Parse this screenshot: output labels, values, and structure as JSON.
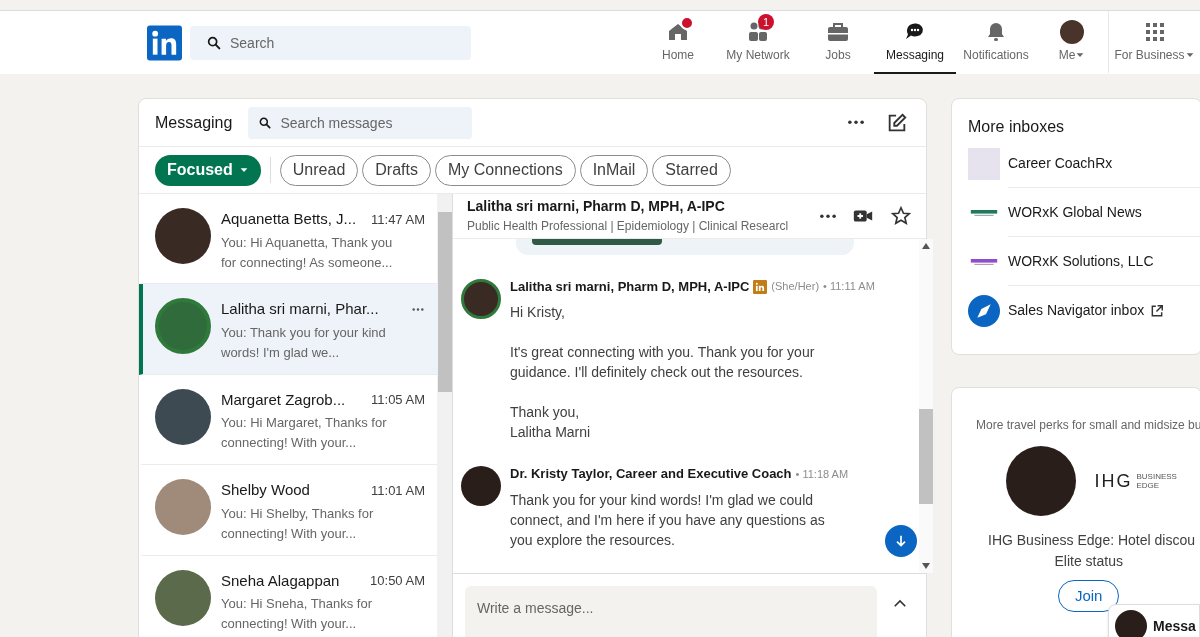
{
  "nav": {
    "search": {
      "placeholder": "Search"
    },
    "items": [
      {
        "kind": "home",
        "label": "Home",
        "selected": false,
        "dot": true
      },
      {
        "kind": "network",
        "label": "My Network",
        "selected": false,
        "badge": "1"
      },
      {
        "kind": "jobs",
        "label": "Jobs",
        "selected": false
      },
      {
        "kind": "messaging",
        "label": "Messaging",
        "selected": true
      },
      {
        "kind": "bell",
        "label": "Notifications",
        "selected": false
      },
      {
        "kind": "me",
        "label": "Me",
        "selected": false
      },
      {
        "kind": "grid",
        "label": "For Business",
        "selected": false
      }
    ]
  },
  "messaging": {
    "title": "Messaging",
    "search": {
      "placeholder": "Search messages"
    },
    "filters": [
      {
        "label": "Focused",
        "kind": "dropdown",
        "selected": true
      },
      {
        "label": "Unread",
        "kind": "pill",
        "selected": false
      },
      {
        "label": "Drafts",
        "kind": "pill",
        "selected": false
      },
      {
        "label": "My Connections",
        "kind": "pill",
        "selected": false
      },
      {
        "label": "InMail",
        "kind": "pill",
        "selected": false
      },
      {
        "label": "Starred",
        "kind": "pill",
        "selected": false
      }
    ],
    "conversations": [
      {
        "name": "Aquanetta Betts, J...",
        "time": "11:47 AM",
        "preview": "You: Hi Aquanetta, Thank you for connecting! As someone...",
        "selected": false
      },
      {
        "name": "Lalitha sri marni, Phar...",
        "preview": "You: Thank you for your kind words! I'm glad we...",
        "selected": true
      },
      {
        "name": "Margaret Zagrob...",
        "time": "11:05 AM",
        "preview": "You: Hi Margaret, Thanks for connecting! With your...",
        "selected": false
      },
      {
        "name": "Shelby Wood",
        "time": "11:01 AM",
        "preview": "You: Hi Shelby, Thanks for connecting! With your...",
        "selected": false
      },
      {
        "name": "Sneha Alagappan",
        "time": "10:50 AM",
        "preview": "You: Hi Sneha, Thanks for connecting! With your...",
        "selected": false
      }
    ],
    "thread": {
      "name": "Lalitha sri marni, Pharm D, MPH, A-IPC",
      "headline": "Public Health Professional | Epidemiology | Clinical Researcl",
      "messages": [
        {
          "sender": "Lalitha sri marni, Pharm D, MPH, A-IPC",
          "premium": true,
          "pronouns": "(She/Her)",
          "time": "• 11:11 AM",
          "paragraphs": [
            "Hi Kristy,",
            "It's great connecting with you. Thank you for your guidance. I'll definitely check out the resources.",
            "Thank you,\nLalitha Marni"
          ]
        },
        {
          "sender": "Dr. Kristy Taylor, Career and Executive Coach",
          "premium": false,
          "time": "• 11:18 AM",
          "paragraphs": [
            "Thank you for your kind words! I'm glad we could connect, and I'm here if you have any questions as you explore the resources."
          ]
        }
      ],
      "compose": {
        "placeholder": "Write a message..."
      }
    }
  },
  "more_inboxes": {
    "title": "More inboxes",
    "items": [
      {
        "kind": "photo",
        "label": "Career CoachRx",
        "external": false
      },
      {
        "kind": "logo_green",
        "label": "WORxK Global News",
        "external": false
      },
      {
        "kind": "logo_purple",
        "label": "WORxK Solutions, LLC",
        "external": false
      },
      {
        "kind": "compass",
        "label": "Sales Navigator inbox",
        "external": true
      }
    ]
  },
  "ad": {
    "tagline": "More travel perks for small and midsize bu",
    "brand": "IHG",
    "brand_sub": "BUSINESS\nEDGE",
    "headline": "IHG Business Edge: Hotel discou",
    "headline_2": "Elite status",
    "button": "Join"
  },
  "messaging_bar": {
    "label": "Messa"
  }
}
